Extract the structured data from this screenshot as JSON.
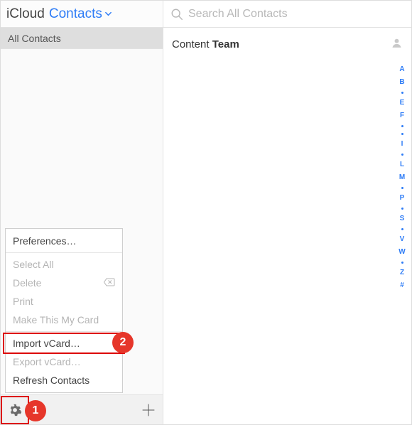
{
  "header": {
    "brand": "iCloud",
    "app": "Contacts"
  },
  "sidebar": {
    "groups": [
      "All Contacts"
    ]
  },
  "search": {
    "placeholder": "Search All Contacts"
  },
  "contacts": [
    {
      "first": "Content",
      "last": "Team"
    }
  ],
  "alpha_index": [
    "A",
    "B",
    "•",
    "E",
    "F",
    "•",
    "•",
    "I",
    "•",
    "L",
    "M",
    "•",
    "P",
    "•",
    "S",
    "•",
    "V",
    "W",
    "•",
    "Z",
    "#"
  ],
  "menu": {
    "preferences": "Preferences…",
    "select_all": "Select All",
    "delete": "Delete",
    "print": "Print",
    "make_my_card": "Make This My Card",
    "import_vcard": "Import vCard…",
    "export_vcard": "Export vCard…",
    "refresh": "Refresh Contacts"
  },
  "annotations": {
    "gear": "1",
    "import": "2"
  }
}
